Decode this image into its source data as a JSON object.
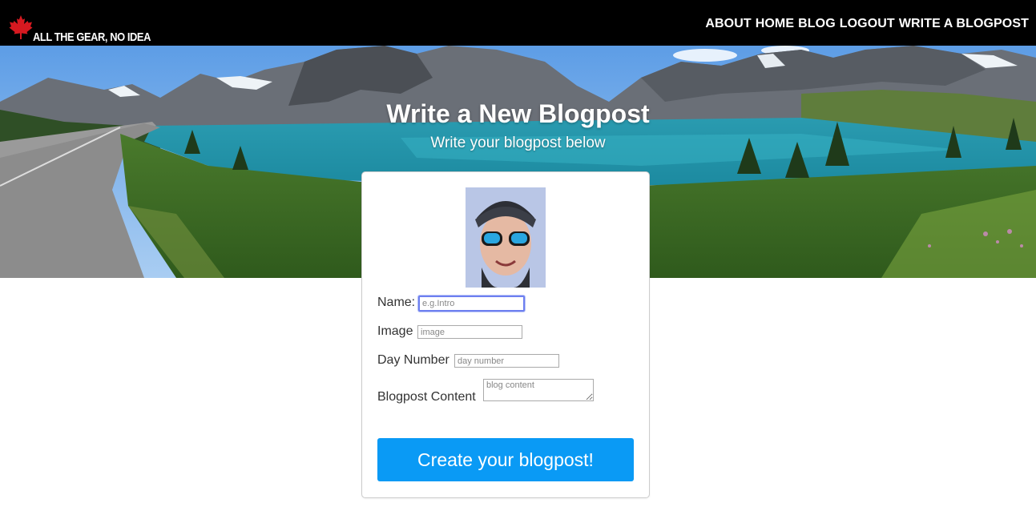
{
  "nav": {
    "brand": "ALL THE GEAR, NO IDEA",
    "links": [
      "ABOUT",
      "HOME",
      "BLOG",
      "LOGOUT",
      "WRITE A BLOGPOST"
    ]
  },
  "hero": {
    "title": "Write a New Blogpost",
    "subtitle": "Write your blogpost below"
  },
  "form": {
    "name_label": "Name:",
    "name_placeholder": "e.g.Intro",
    "image_label": "Image",
    "image_placeholder": "image",
    "day_label": "Day Number",
    "day_placeholder": "day number",
    "content_label": "Blogpost Content",
    "content_placeholder": "blog content",
    "submit_label": "Create your blogpost!"
  },
  "colors": {
    "nav_bg": "#000000",
    "button_bg": "#0a9af5",
    "focus_ring": "#6d7ff0"
  },
  "icons": [
    "maple-leaf-icon"
  ]
}
